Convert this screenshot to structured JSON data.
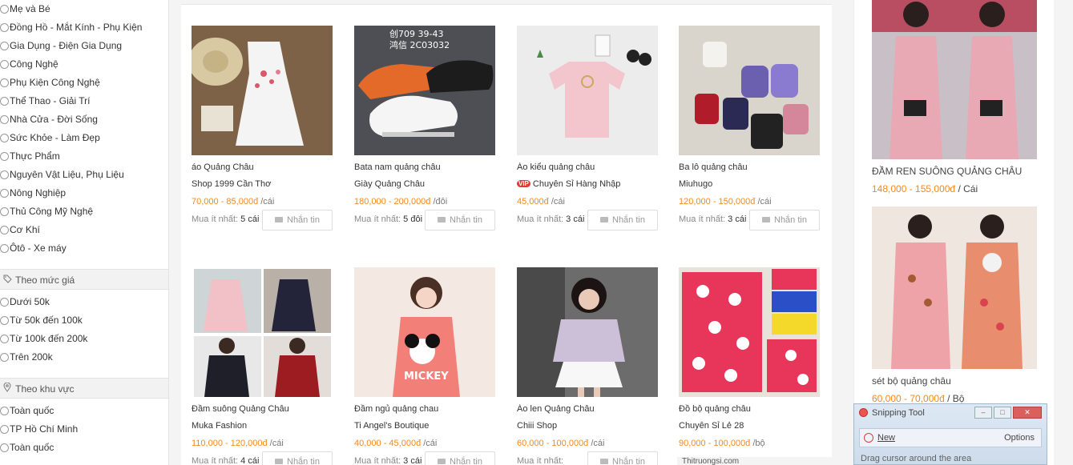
{
  "sidebar": {
    "categories": [
      "Mẹ và Bé",
      "Đồng Hồ - Mắt Kính - Phụ Kiện",
      "Gia Dụng - Điện Gia Dụng",
      "Công Nghệ",
      "Phụ Kiện Công Nghệ",
      "Thể Thao - Giải Trí",
      "Nhà Cửa - Đời Sống",
      "Sức Khỏe - Làm Đẹp",
      "Thực Phẩm",
      "Nguyên Vật Liệu, Phụ Liệu",
      "Nông Nghiệp",
      "Thủ Công Mỹ Nghệ",
      "Cơ Khí",
      "Ôtô - Xe máy"
    ],
    "price_filter": {
      "heading": "Theo mức giá",
      "options": [
        "Dưới 50k",
        "Từ 50k đến 100k",
        "Từ 100k đến 200k",
        "Trên 200k"
      ]
    },
    "region_filter": {
      "heading": "Theo khu vực",
      "options": [
        "Toàn quốc",
        "TP Hồ Chí Minh",
        "Toàn quốc"
      ]
    }
  },
  "products": [
    {
      "title": "áo Quảng Châu",
      "shop": "Shop 1999 Cần Thơ",
      "vip": false,
      "price": "70,000 - 85,000đ",
      "unit": "/cái",
      "min_label": "Mua ít nhất:",
      "min_qty": "5 cái",
      "message": "Nhắn tin"
    },
    {
      "title": "Bata nam quảng châu",
      "shop": "Giày Quảng Châu",
      "vip": false,
      "price": "180,000 - 200,000đ",
      "unit": "/đôi",
      "min_label": "Mua ít nhất:",
      "min_qty": "5 đôi",
      "message": "Nhắn tin"
    },
    {
      "title": "Áo kiểu quảng châu",
      "shop": "Chuyên Sỉ Hàng Nhập",
      "vip": true,
      "vip_label": "VIP",
      "price": "45,000đ",
      "unit": "/cái",
      "min_label": "Mua ít nhất:",
      "min_qty": "3 cái",
      "message": "Nhắn tin"
    },
    {
      "title": "Ba lô quảng châu",
      "shop": "Miuhugo",
      "vip": false,
      "price": "120,000 - 150,000đ",
      "unit": "/cái",
      "min_label": "Mua ít nhất:",
      "min_qty": "3 cái",
      "message": "Nhắn tin"
    },
    {
      "title": "Đầm suông Quảng Châu",
      "shop": "Muka Fashion",
      "vip": false,
      "price": "110,000 - 120,000đ",
      "unit": "/cái",
      "min_label": "Mua ít nhất:",
      "min_qty": "4 cái",
      "message": "Nhắn tin"
    },
    {
      "title": "Đầm ngủ quảng chau",
      "shop": "Ti Angel's Boutique",
      "vip": false,
      "price": "40,000 - 45,000đ",
      "unit": "/cái",
      "min_label": "Mua ít nhất:",
      "min_qty": "3 cái",
      "message": "Nhắn tin"
    },
    {
      "title": "Áo len Quảng Châu",
      "shop": "Chiii Shop",
      "vip": false,
      "price": "60,000 - 100,000đ",
      "unit": "/cái",
      "min_label": "Mua ít nhất:",
      "min_qty": "",
      "message": "Nhắn tin"
    },
    {
      "title": "Đồ bộ quảng châu",
      "shop": "Chuyên Sỉ Lẻ 28",
      "vip": false,
      "price": "90,000 - 100,000đ",
      "unit": "/bộ",
      "min_label": "",
      "min_qty": "",
      "message": ""
    }
  ],
  "featured": [
    {
      "title": "ĐẦM REN SUÔNG QUẢNG CHÂU",
      "price": "148,000 - 155,000đ",
      "unit": "/ Cái"
    },
    {
      "title": "sét bộ quảng châu",
      "price": "60,000 - 70,000đ",
      "unit": "/ Bộ"
    }
  ],
  "bottom_site": "Thitruongsi.com",
  "snipping_tool": {
    "title": "Snipping Tool",
    "new_label": "New",
    "options_label": "Options",
    "help_text": "Drag cursor around the area"
  }
}
